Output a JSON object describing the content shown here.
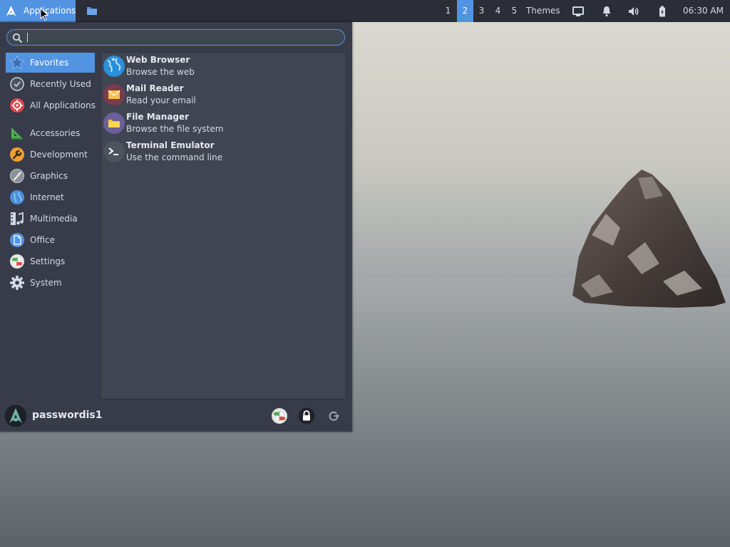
{
  "panel": {
    "applications_label": "Applications",
    "workspaces": [
      "1",
      "2",
      "3",
      "4",
      "5"
    ],
    "active_workspace": "2",
    "themes_label": "Themes",
    "clock": "06:30 AM",
    "tray_icons": [
      "display-icon",
      "notification-bell-icon",
      "volume-icon",
      "battery-icon"
    ]
  },
  "menu": {
    "search": {
      "value": "",
      "placeholder": ""
    },
    "categories": [
      {
        "label": "Favorites",
        "icon": "star-icon",
        "selected": true
      },
      {
        "label": "Recently Used",
        "icon": "clock-icon"
      },
      {
        "label": "All Applications",
        "icon": "all-applications-icon"
      },
      {
        "label": "Accessories",
        "icon": "accessories-icon"
      },
      {
        "label": "Development",
        "icon": "wrench-icon"
      },
      {
        "label": "Graphics",
        "icon": "graphics-brush-icon"
      },
      {
        "label": "Internet",
        "icon": "globe-icon"
      },
      {
        "label": "Multimedia",
        "icon": "multimedia-icon"
      },
      {
        "label": "Office",
        "icon": "document-icon"
      },
      {
        "label": "Settings",
        "icon": "toggle-settings-icon"
      },
      {
        "label": "System",
        "icon": "gear-icon"
      }
    ],
    "apps": [
      {
        "name": "Web Browser",
        "description": "Browse the web",
        "icon": "web-browser-icon"
      },
      {
        "name": "Mail Reader",
        "description": "Read your email",
        "icon": "mail-icon"
      },
      {
        "name": "File Manager",
        "description": "Browse the file system",
        "icon": "folder-icon"
      },
      {
        "name": "Terminal Emulator",
        "description": "Use the command line",
        "icon": "terminal-icon"
      }
    ],
    "user": {
      "name": "passwordis1"
    },
    "footer_actions": [
      "settings-manager-icon",
      "lock-screen-icon",
      "log-out-icon"
    ]
  },
  "colors": {
    "accent": "#5294e2",
    "panel_bg": "#2b2e37",
    "menu_bg": "#383c4a",
    "list_bg": "#404552",
    "text": "#d3dae3"
  }
}
